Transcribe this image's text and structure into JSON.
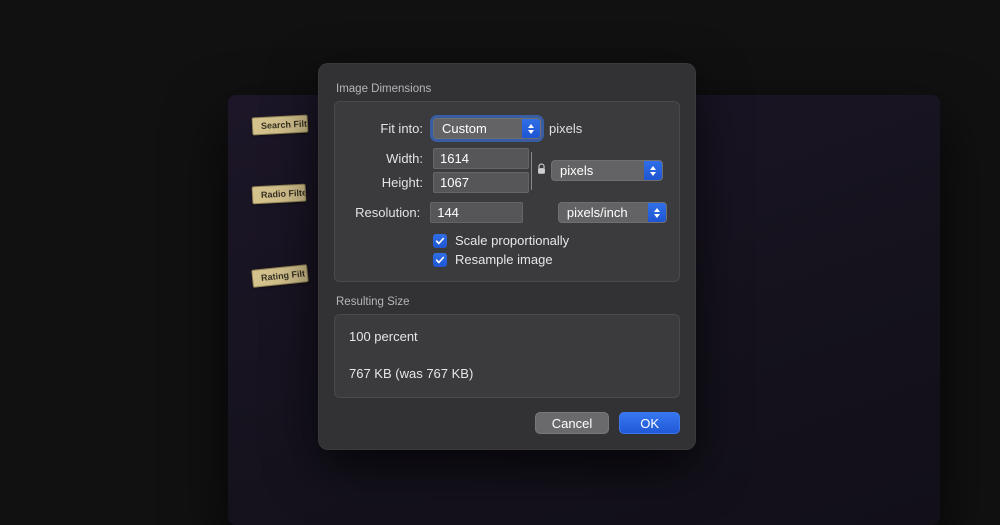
{
  "bg_tags": {
    "t1": "Search Filt",
    "t2": "Radio Filte",
    "t3": "Rating Filt"
  },
  "dialog": {
    "section_dimensions": "Image Dimensions",
    "fit_into_label": "Fit into:",
    "fit_into_value": "Custom",
    "fit_into_unit": "pixels",
    "width_label": "Width:",
    "width_value": "1614",
    "height_label": "Height:",
    "height_value": "1067",
    "wh_unit_value": "pixels",
    "resolution_label": "Resolution:",
    "resolution_value": "144",
    "resolution_unit_value": "pixels/inch",
    "scale_proportionally": "Scale proportionally",
    "resample_image": "Resample image",
    "scale_checked": true,
    "resample_checked": true,
    "section_result": "Resulting Size",
    "result_percent": "100 percent",
    "result_size": "767 KB (was 767 KB)",
    "cancel": "Cancel",
    "ok": "OK"
  }
}
